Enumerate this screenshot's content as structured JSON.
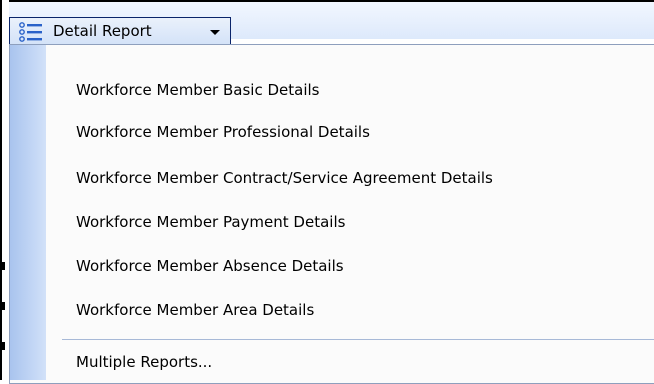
{
  "toolbar": {
    "menu_button_label": "Detail Report",
    "menu_button_icon": "list-icon",
    "dropdown_icon": "caret-down-icon",
    "accent_color": "#0a246a"
  },
  "menu": {
    "items": [
      {
        "label": "Workforce Member Basic Details"
      },
      {
        "label": "Workforce Member Professional Details"
      },
      {
        "label": "Workforce Member Contract/Service Agreement Details"
      },
      {
        "label": "Workforce Member Payment Details"
      },
      {
        "label": "Workforce Member Absence Details"
      },
      {
        "label": "Workforce Member Area Details"
      }
    ],
    "footer_item": {
      "label": "Multiple Reports..."
    }
  }
}
